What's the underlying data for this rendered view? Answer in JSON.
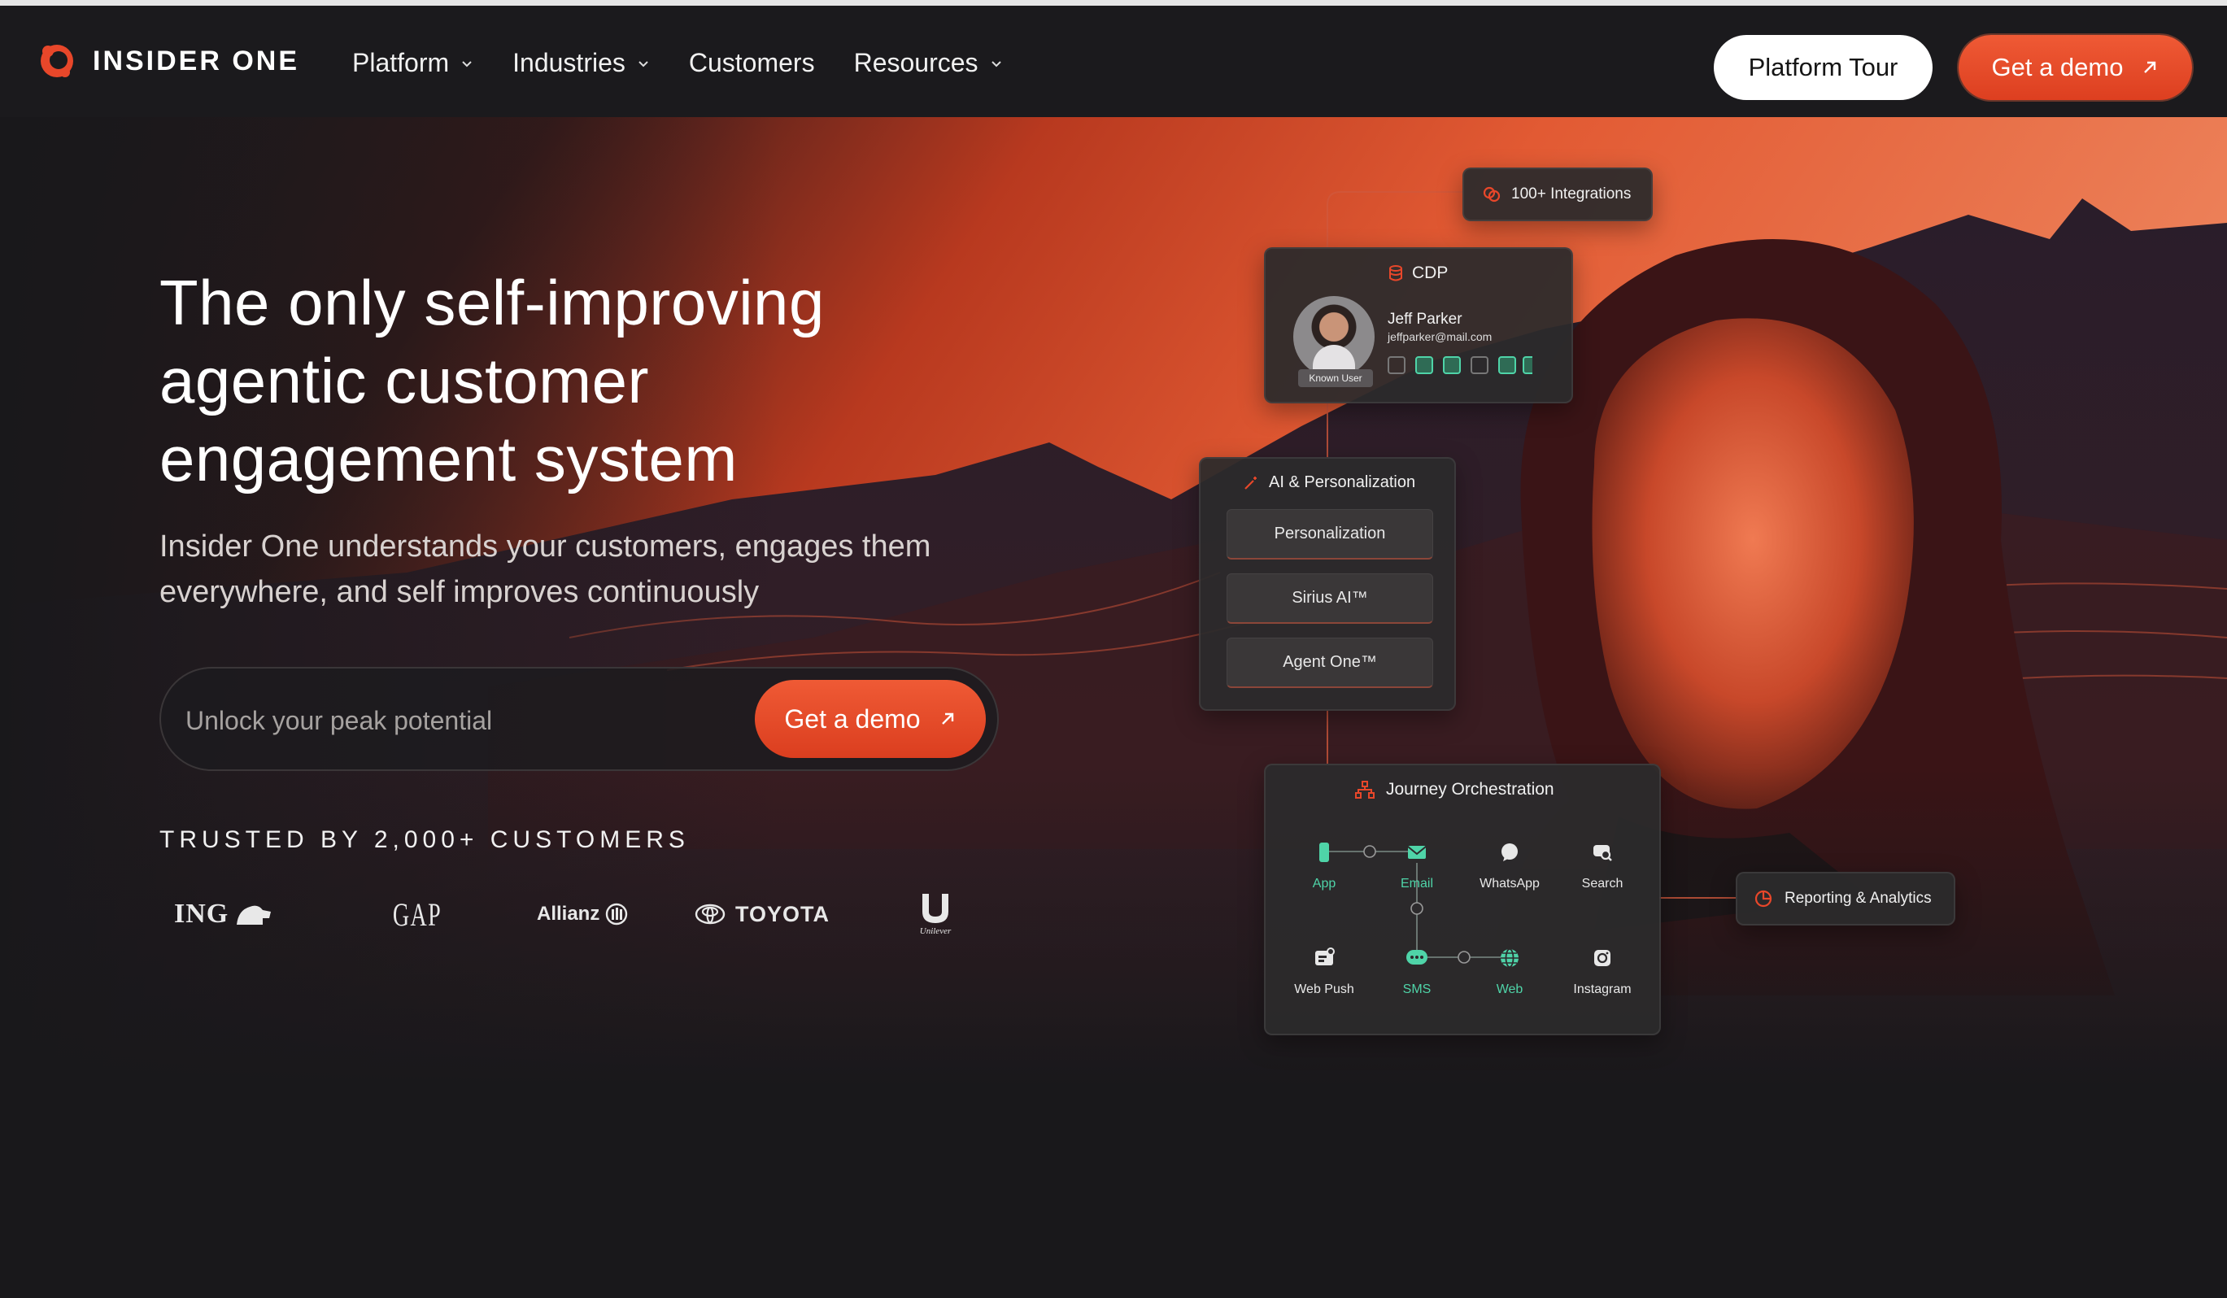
{
  "brand": {
    "name": "INSIDER ONE",
    "accent": "#e8472a"
  },
  "nav": {
    "items": [
      {
        "label": "Platform",
        "has_dropdown": true
      },
      {
        "label": "Industries",
        "has_dropdown": true
      },
      {
        "label": "Customers",
        "has_dropdown": false
      },
      {
        "label": "Resources",
        "has_dropdown": true
      }
    ],
    "platform_tour": "Platform Tour",
    "get_demo": "Get a demo"
  },
  "hero": {
    "headline_1": "The only self-improving",
    "headline_2": "agentic customer",
    "headline_3": "engagement system",
    "subhead_1": "Insider One understands your customers, engages them",
    "subhead_2": "everywhere, and self improves continuously",
    "signup": {
      "placeholder": "Unlock your peak potential",
      "button": "Get a demo"
    },
    "trusted": "TRUSTED BY 2,000+ CUSTOMERS",
    "customers": [
      "ING",
      "GAP",
      "Allianz",
      "TOYOTA",
      "Unilever"
    ]
  },
  "diagram": {
    "integrations": "100+ Integrations",
    "cdp": {
      "title": "CDP",
      "user_name": "Jeff Parker",
      "user_email": "jeffparker@mail.com",
      "badge": "Known User"
    },
    "ai": {
      "title": "AI & Personalization",
      "items": [
        "Personalization",
        "Sirius AI™",
        "Agent One™"
      ]
    },
    "journey": {
      "title": "Journey Orchestration",
      "channels": [
        {
          "label": "App",
          "icon": "mobile-icon",
          "active": true
        },
        {
          "label": "Email",
          "icon": "mail-icon",
          "active": true
        },
        {
          "label": "WhatsApp",
          "icon": "whatsapp-icon",
          "active": false
        },
        {
          "label": "Search",
          "icon": "search-icon",
          "active": false
        },
        {
          "label": "Web Push",
          "icon": "web-push-icon",
          "active": false
        },
        {
          "label": "SMS",
          "icon": "sms-icon",
          "active": true
        },
        {
          "label": "Web",
          "icon": "globe-icon",
          "active": true
        },
        {
          "label": "Instagram",
          "icon": "instagram-icon",
          "active": false
        }
      ]
    },
    "reporting": "Reporting & Analytics"
  }
}
